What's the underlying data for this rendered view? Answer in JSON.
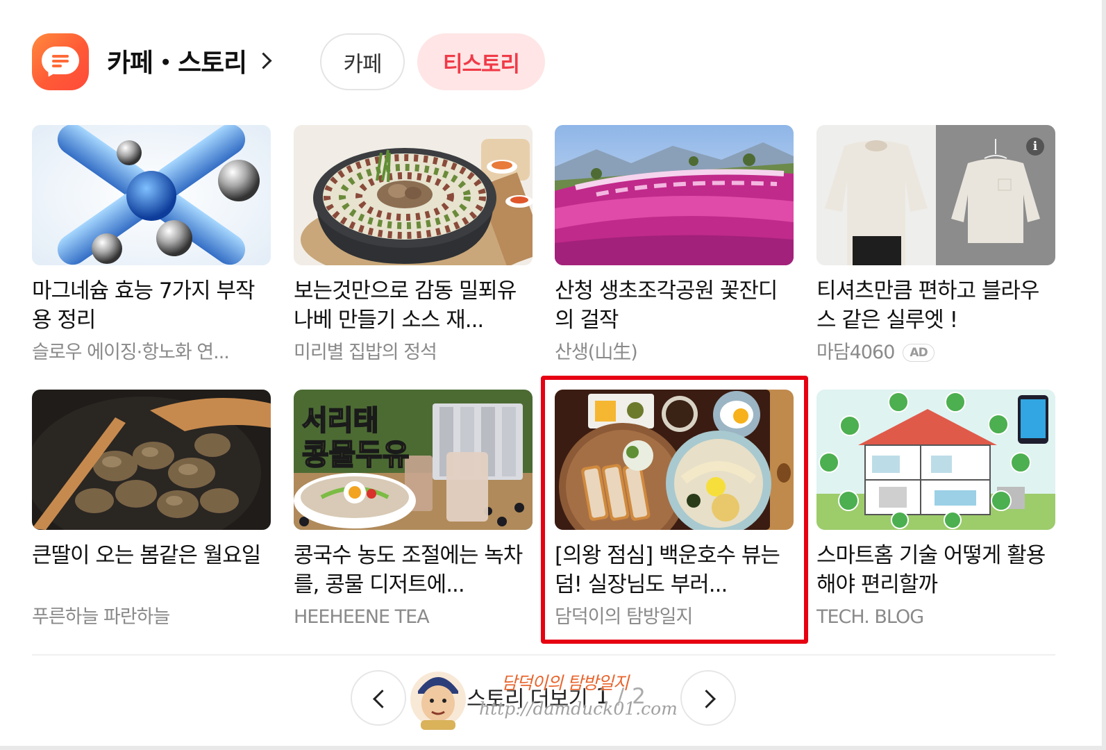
{
  "header": {
    "title": "카페・스토리",
    "tabs": [
      {
        "label": "카페",
        "selected": false
      },
      {
        "label": "티스토리",
        "selected": true
      }
    ]
  },
  "cards": [
    {
      "title": "마그네슘 효능 7가지 부작용 정리",
      "source": "슬로우 에이징·항노화 연...",
      "image": "blue-magnesium-capsules"
    },
    {
      "title": "보는것만으로 감동 밀푀유나베 만들기 소스 재...",
      "source": "미리별 집밥의 정석",
      "image": "millefeuille-nabe-pot"
    },
    {
      "title": "산청 생초조각공원 꽃잔디의 걸작",
      "source": "산생(山生)",
      "image": "pink-flower-hillside"
    },
    {
      "title": "티셔츠만큼 편하고 블라우스 같은 실루엣 !",
      "source": "마담4060",
      "ad": "AD",
      "image": "white-blouse-ad"
    },
    {
      "title": "큰딸이 오는 봄같은 월요일",
      "source": "푸른하늘 파란하늘",
      "image": "braised-chicken-pan"
    },
    {
      "title": "콩국수 농도 조절에는 녹차를, 콩물 디저트에...",
      "source": "HEEHEENE TEA",
      "image": "soy-noodle-product",
      "image_text": [
        "서리태",
        "콩물두유"
      ]
    },
    {
      "title": "[의왕 점심] 백운호수 뷰는 덤! 실장님도 부러...",
      "source": "담덕이의 탐방일지",
      "image": "pork-cutlet-tray",
      "highlighted": true
    },
    {
      "title": "스마트홈 기술 어떻게 활용해야 편리할까",
      "source": "TECH. BLOG",
      "image": "smart-home-diagram"
    }
  ],
  "footer": {
    "more_label": "스토리 더보기",
    "page_current": "1",
    "page_separator": "/",
    "page_total": "2"
  },
  "watermark": {
    "title": "담덕이의 탐방일지",
    "url": "http://damduck01.com"
  }
}
